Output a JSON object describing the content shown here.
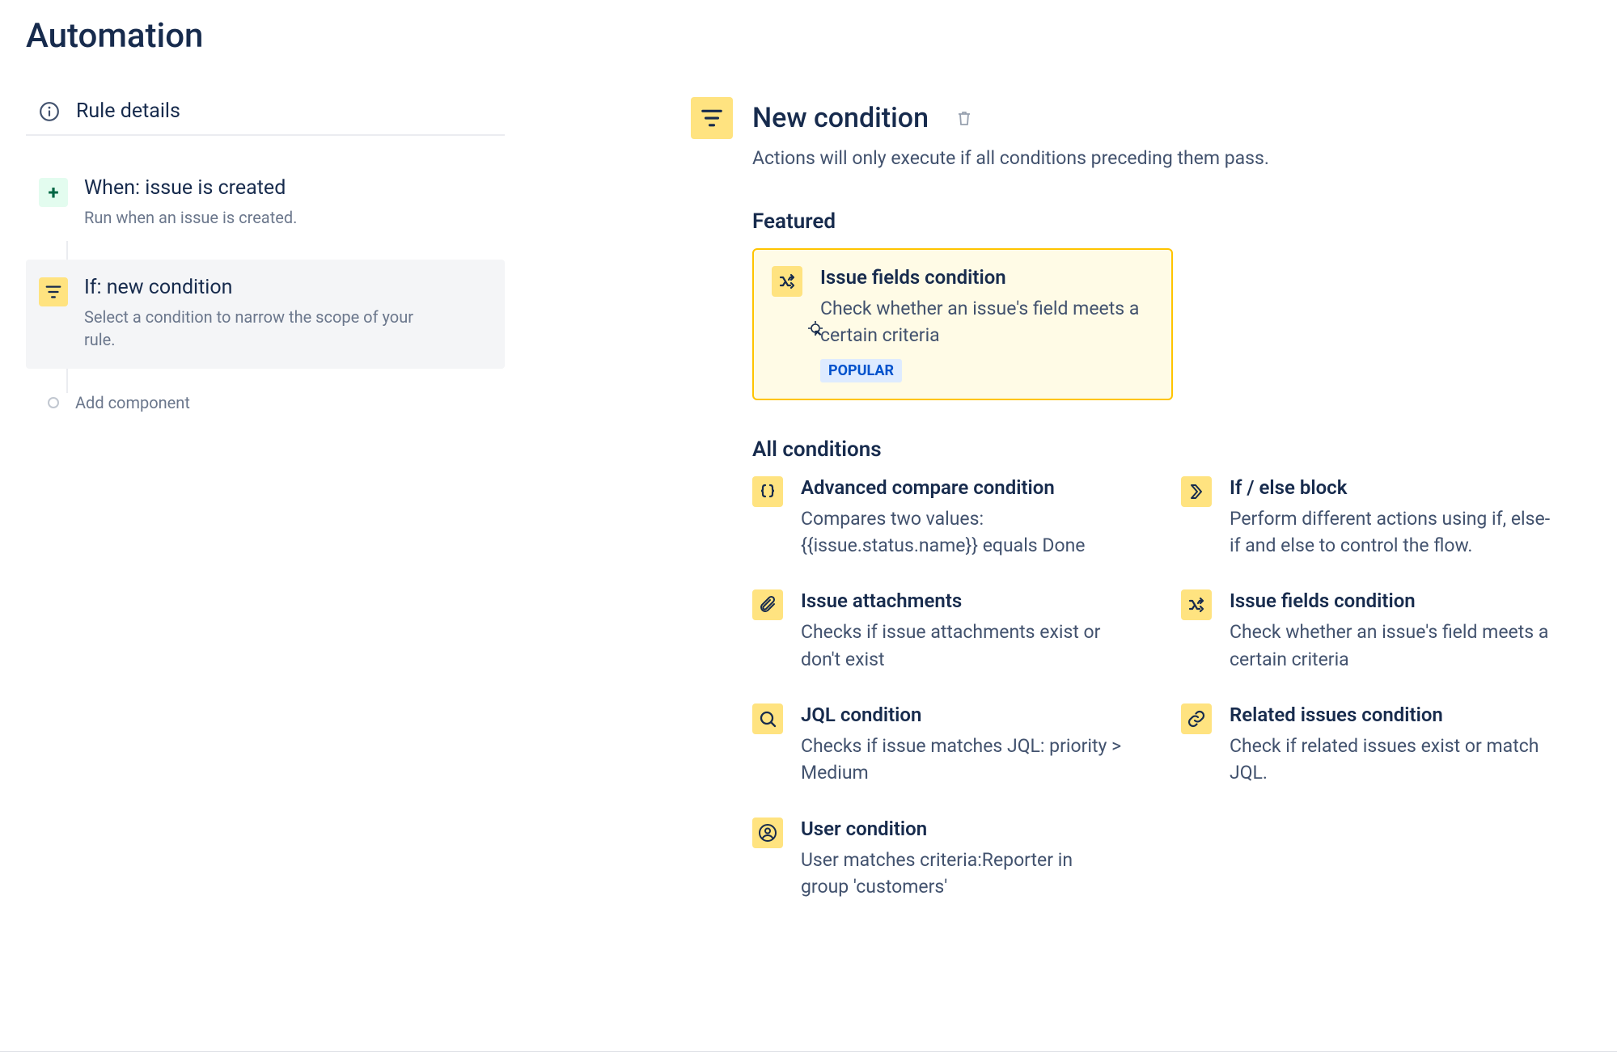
{
  "page": {
    "title": "Automation"
  },
  "sidebar": {
    "ruleDetails": "Rule details",
    "trigger": {
      "title": "When: issue is created",
      "desc": "Run when an issue is created."
    },
    "condition": {
      "title": "If: new condition",
      "desc": "Select a condition to narrow the scope of your rule."
    },
    "addComponent": "Add component"
  },
  "panel": {
    "title": "New condition",
    "subtitle": "Actions will only execute if all conditions preceding them pass.",
    "featuredHeading": "Featured",
    "allHeading": "All conditions",
    "featured": {
      "title": "Issue fields condition",
      "desc": "Check whether an issue's field meets a certain criteria",
      "badge": "POPULAR"
    },
    "conditions": [
      {
        "icon": "braces",
        "title": "Advanced compare condition",
        "desc": "Compares two values: {{issue.status.name}} equals Done"
      },
      {
        "icon": "branch",
        "title": "If / else block",
        "desc": "Perform different actions using if, else-if and else to control the flow."
      },
      {
        "icon": "attachment",
        "title": "Issue attachments",
        "desc": "Checks if issue attachments exist or don't exist"
      },
      {
        "icon": "shuffle",
        "title": "Issue fields condition",
        "desc": "Check whether an issue's field meets a certain criteria"
      },
      {
        "icon": "search",
        "title": "JQL condition",
        "desc": "Checks if issue matches JQL: priority > Medium"
      },
      {
        "icon": "link",
        "title": "Related issues condition",
        "desc": "Check if related issues exist or match JQL."
      },
      {
        "icon": "user",
        "title": "User condition",
        "desc": "User matches criteria:Reporter in group 'customers'"
      }
    ]
  }
}
